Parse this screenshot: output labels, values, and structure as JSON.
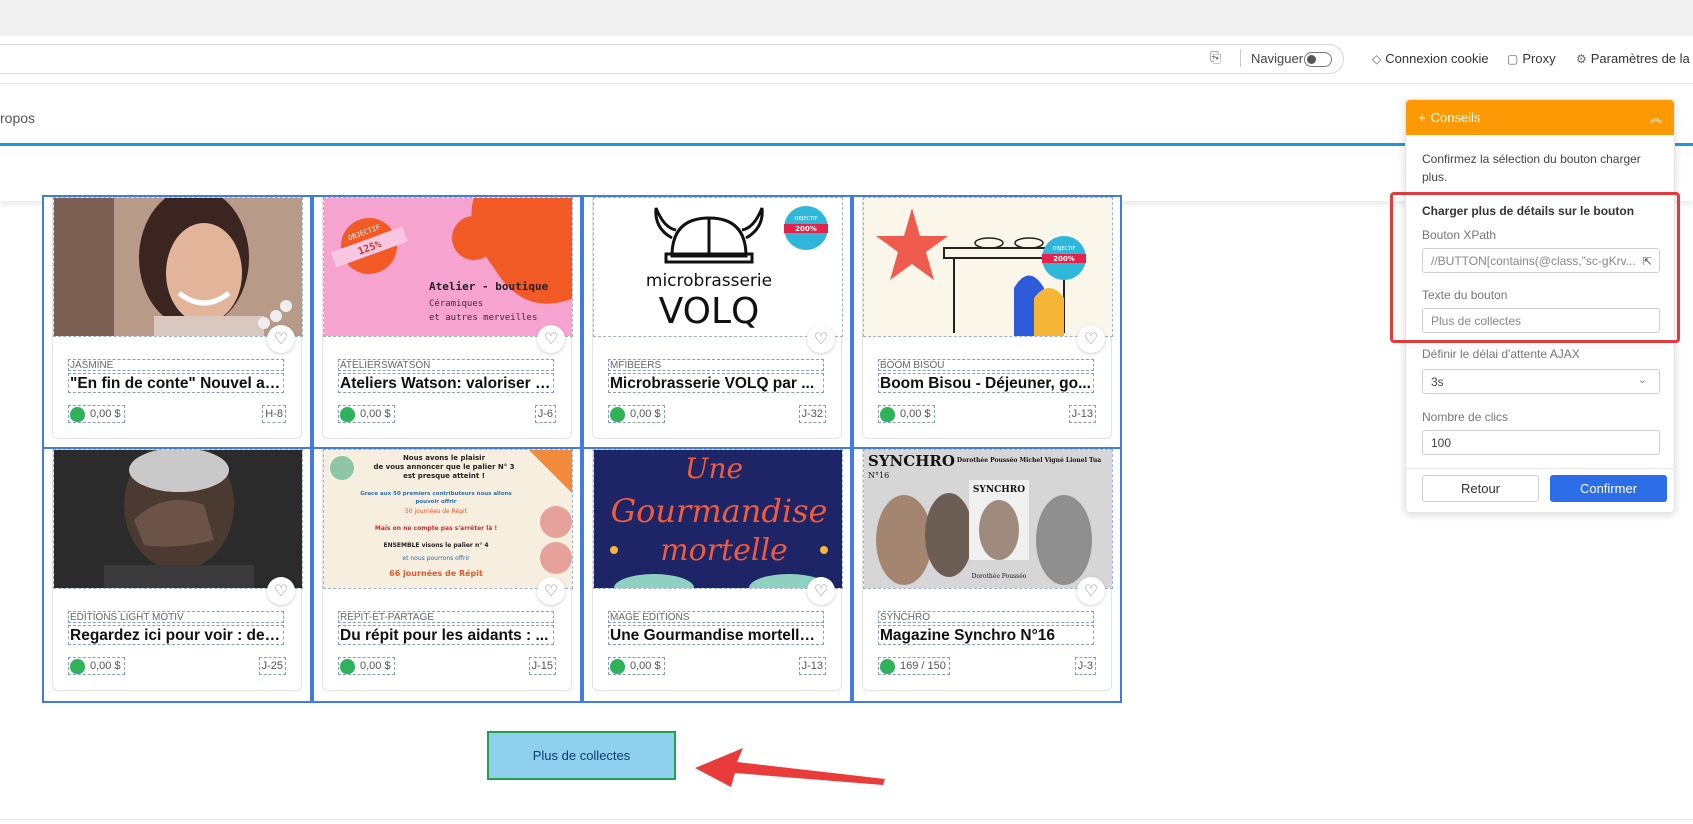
{
  "toolbar": {
    "navigate_label": "Naviguer",
    "cookie_login": "Connexion cookie",
    "proxy": "Proxy",
    "task_settings": "Paramètres de la t"
  },
  "site": {
    "nav_fragment": "ropos"
  },
  "cards": [
    {
      "org": "JASMINE",
      "title": "\"En fin de conte\" Nouvel alb...",
      "amount": "0,00 $",
      "days": "H-8",
      "img": "portrait-woman"
    },
    {
      "org": "ATELIERSWATSON",
      "title": "Ateliers Watson: valoriser l'...",
      "amount": "0,00 $",
      "days": "J-6",
      "img": "atelier"
    },
    {
      "org": "MFIBEERS",
      "title": "Microbrasserie VOLQ par ...",
      "amount": "0,00 $",
      "days": "J-32",
      "img": "volq"
    },
    {
      "org": "BOOM BISOU",
      "title": "Boom Bisou - Déjeuner, go...",
      "amount": "0,00 $",
      "days": "J-13",
      "img": "boombisou"
    },
    {
      "org": "EDITIONS LIGHT MOTIV",
      "title": "Regardez ici pour voir : des ...",
      "amount": "0,00 $",
      "days": "J-25",
      "img": "portrait-man"
    },
    {
      "org": "REPIT-ET-PARTAGE",
      "title": "Du répit pour les aidants : ...",
      "amount": "0,00 $",
      "days": "J-15",
      "img": "repit"
    },
    {
      "org": "MAGE EDITIONS",
      "title": "Une Gourmandise mortelle ...",
      "amount": "0,00 $",
      "days": "J-13",
      "img": "gourmandise"
    },
    {
      "org": "SYNCHRO",
      "title": "Magazine Synchro N°16",
      "amount": "169 / 150",
      "days": "J-3",
      "img": "synchro"
    }
  ],
  "images": {
    "atelier_badge": "OBJECTIF",
    "atelier_badge_value": "125%",
    "atelier_title": "Atelier - boutique",
    "atelier_sub1": "Céramiques",
    "atelier_sub2": "et autres merveilles",
    "volq_name": "microbrasserie",
    "volq_brand": "VOLQ",
    "badge_objectif": "OBJECTIF",
    "badge_200": "200%",
    "repit_l1": "Nous avons le plaisir",
    "repit_l2": "de vous annoncer que le palier N° 3",
    "repit_l3": "est presque atteint !",
    "repit_l4": "Grace aux 50 premiers contributeurs nous allons",
    "repit_l5": "pouvoir offrir",
    "repit_l6": "50 journées de Répit",
    "repit_l7": "Mais on ne compte pas s'arrêter là !",
    "repit_l8": "ENSEMBLE visons le palier n° 4",
    "repit_l9": "et nous pourrons offrir",
    "repit_l10": "66 journées de Répit",
    "gourm_l1": "Une",
    "gourm_l2": "Gourmandise",
    "gourm_l3": "mortelle",
    "synchro_title": "SYNCHRO",
    "synchro_no": "N°16",
    "synchro_names": "Dorothée Pousséo   Michel Vigné   Lionel Tua",
    "synchro_inner": "SYNCHRO",
    "synchro_caption": "Dorothée Pousséo"
  },
  "more_button": "Plus de collectes",
  "panel": {
    "header": "Conseils",
    "description": "Confirmez la sélection du bouton charger plus.",
    "section_title": "Charger plus de détails sur le bouton",
    "xpath_label": "Bouton XPath",
    "xpath_value": "//BUTTON[contains(@class,\"sc-gKrv...",
    "text_label": "Texte du bouton",
    "text_value": "Plus de collectes",
    "ajax_label": "Définir le délai d'attente AJAX",
    "ajax_value": "3s",
    "clicks_label": "Nombre de clics",
    "clicks_value": "100",
    "back": "Retour",
    "confirm": "Confirmer"
  },
  "colors": {
    "accent_orange": "#fd9904",
    "accent_blue": "#2c6de8",
    "selection_blue": "#3f7ce3",
    "highlight_red": "#e23b3b",
    "button_green_border": "#23a24d"
  }
}
